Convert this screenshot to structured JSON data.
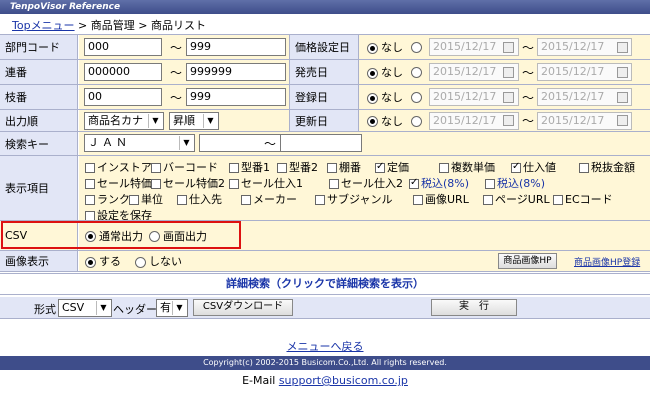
{
  "app_title": "TenpoVisor Reference",
  "breadcrumb": {
    "top": "Topメニュー",
    "sep1": " > ",
    "mid": "商品管理",
    "sep2": " > ",
    "current": "商品リスト"
  },
  "form": {
    "dept_code": {
      "label": "部門コード",
      "from": "000",
      "to": "999"
    },
    "serial": {
      "label": "連番",
      "from": "000000",
      "to": "999999"
    },
    "branch": {
      "label": "枝番",
      "from": "00",
      "to": "999"
    },
    "sort": {
      "label": "出力順",
      "field": "商品名カナ",
      "order": "昇順"
    },
    "search_key": {
      "label": "検索キー",
      "field": "ＪＡＮ",
      "value1": "",
      "value2": ""
    },
    "tilde": "～",
    "price_date": {
      "label": "価格設定日",
      "none": "なし",
      "from": "2015/12/17",
      "to": "2015/12/17"
    },
    "release_date": {
      "label": "発売日",
      "none": "なし",
      "from": "2015/12/17",
      "to": "2015/12/17"
    },
    "register_date": {
      "label": "登録日",
      "none": "なし",
      "from": "2015/12/17",
      "to": "2015/12/17"
    },
    "update_date": {
      "label": "更新日",
      "none": "なし",
      "from": "2015/12/17",
      "to": "2015/12/17"
    }
  },
  "display_items": {
    "label": "表示項目",
    "items": [
      {
        "label": "インストア",
        "checked": false
      },
      {
        "label": "バーコード",
        "checked": false
      },
      {
        "label": "型番1",
        "checked": false
      },
      {
        "label": "型番2",
        "checked": false
      },
      {
        "label": "棚番",
        "checked": false
      },
      {
        "label": "定価",
        "checked": true
      },
      {
        "label": "複数単価",
        "checked": false
      },
      {
        "label": "仕入値",
        "checked": true
      },
      {
        "label": "税抜金額",
        "checked": false
      },
      {
        "label": "セール特価1",
        "checked": false
      },
      {
        "label": "セール特価2",
        "checked": false
      },
      {
        "label": "セール仕入1",
        "checked": false
      },
      {
        "label": "セール仕入2",
        "checked": false
      },
      {
        "label": "税込(8%)",
        "checked": true
      },
      {
        "label": "税込(8%)",
        "checked": false
      },
      {
        "label": "ランク",
        "checked": false
      },
      {
        "label": "単位",
        "checked": false
      },
      {
        "label": "仕入先",
        "checked": false
      },
      {
        "label": "メーカー",
        "checked": false
      },
      {
        "label": "サブジャンル",
        "checked": false
      },
      {
        "label": "画像URL",
        "checked": false
      },
      {
        "label": "ページURL",
        "checked": false
      },
      {
        "label": "ECコード",
        "checked": false
      },
      {
        "label": "設定を保存",
        "checked": false
      }
    ]
  },
  "csv": {
    "label": "CSV",
    "normal": "通常出力",
    "screen": "画面出力"
  },
  "image_display": {
    "label": "画像表示",
    "yes": "する",
    "no": "しない",
    "button": "商品画像HP",
    "link": "商品画像HP登録"
  },
  "detail_search": "詳細検索（クリックで詳細検索を表示）",
  "bottom": {
    "format_label": "形式",
    "format_value": "CSV",
    "header_label": "ヘッダー",
    "header_value": "有",
    "download": "CSVダウンロード",
    "execute": "実　行"
  },
  "menu_back": "メニューへ戻る",
  "copyright": "Copyright(c) 2002-2015 Busicom.Co.,Ltd. All rights reserved.",
  "email": {
    "label": "E-Mail",
    "address": "support@busicom.co.jp"
  }
}
